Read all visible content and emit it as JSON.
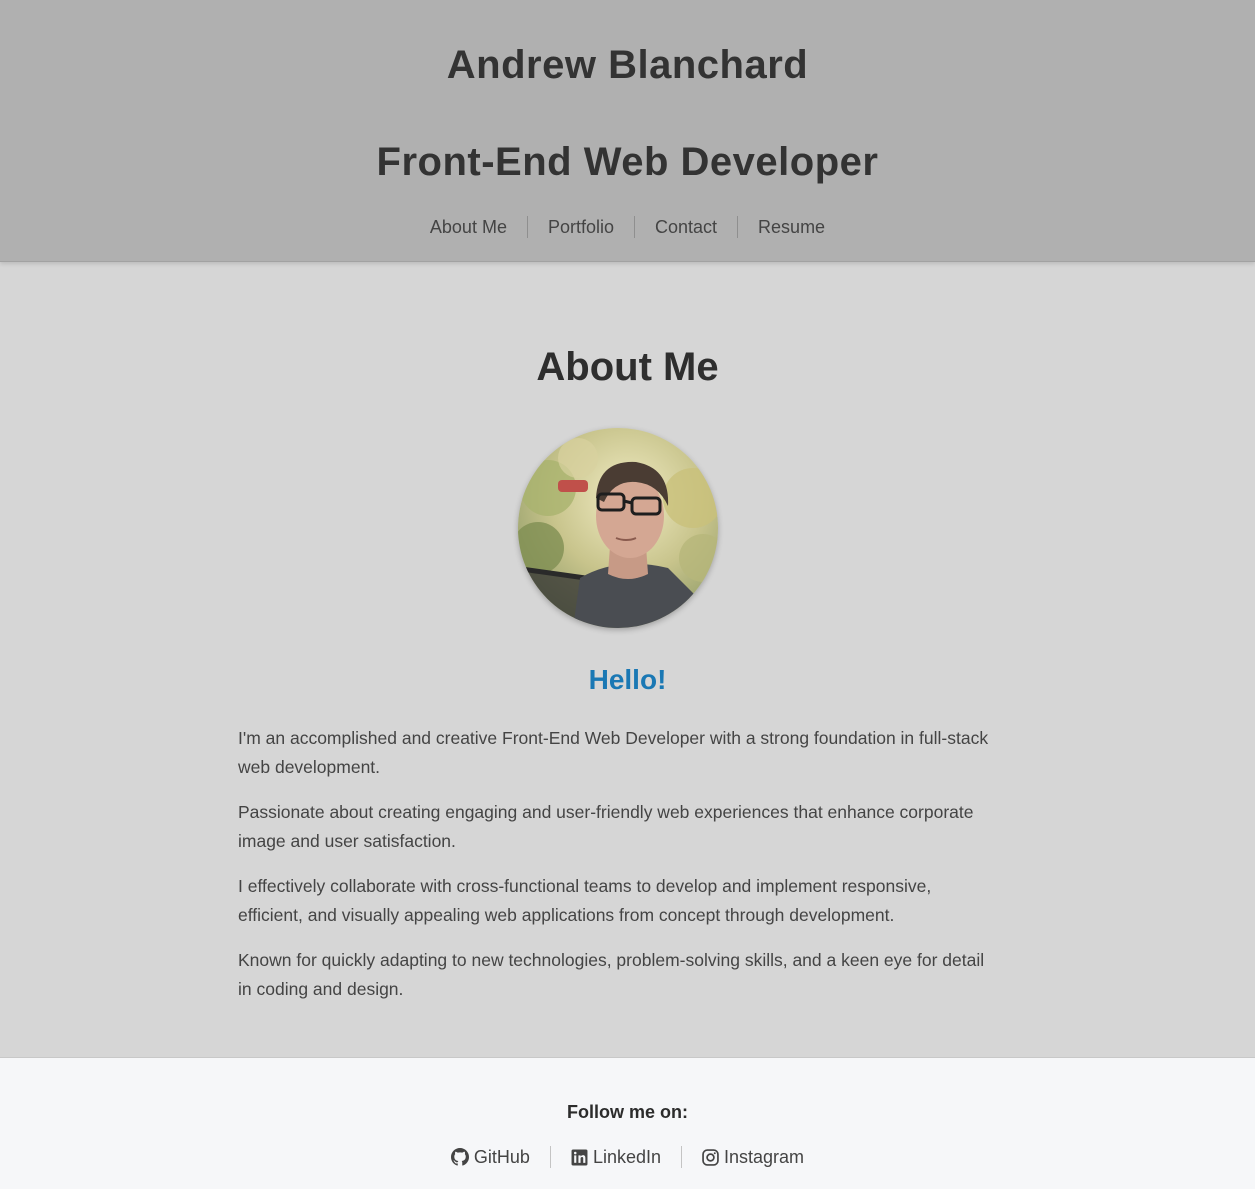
{
  "header": {
    "name": "Andrew Blanchard",
    "role": "Front-End Web Developer"
  },
  "nav": {
    "items": [
      "About Me",
      "Portfolio",
      "Contact",
      "Resume"
    ]
  },
  "about": {
    "title": "About Me",
    "avatar_icon": "profile-photo",
    "greeting": "Hello!",
    "paragraphs": [
      "I'm an accomplished and creative Front-End Web Developer with a strong foundation in full-stack web development.",
      "Passionate about creating engaging and user-friendly web experiences that enhance corporate image and user satisfaction.",
      "I effectively collaborate with cross-functional teams to develop and implement responsive, efficient, and visually appealing web applications from concept through development.",
      "Known for quickly adapting to new technologies, problem-solving skills, and a keen eye for detail in coding and design."
    ]
  },
  "footer": {
    "follow_label": "Follow me on:",
    "links": [
      {
        "label": "GitHub",
        "icon": "github-icon"
      },
      {
        "label": "LinkedIn",
        "icon": "linkedin-icon"
      },
      {
        "label": "Instagram",
        "icon": "instagram-icon"
      }
    ]
  },
  "colors": {
    "header_bg": "#b0b0b0",
    "main_bg": "#d6d6d6",
    "footer_bg": "#f6f7f9",
    "accent": "#1a78b4"
  }
}
